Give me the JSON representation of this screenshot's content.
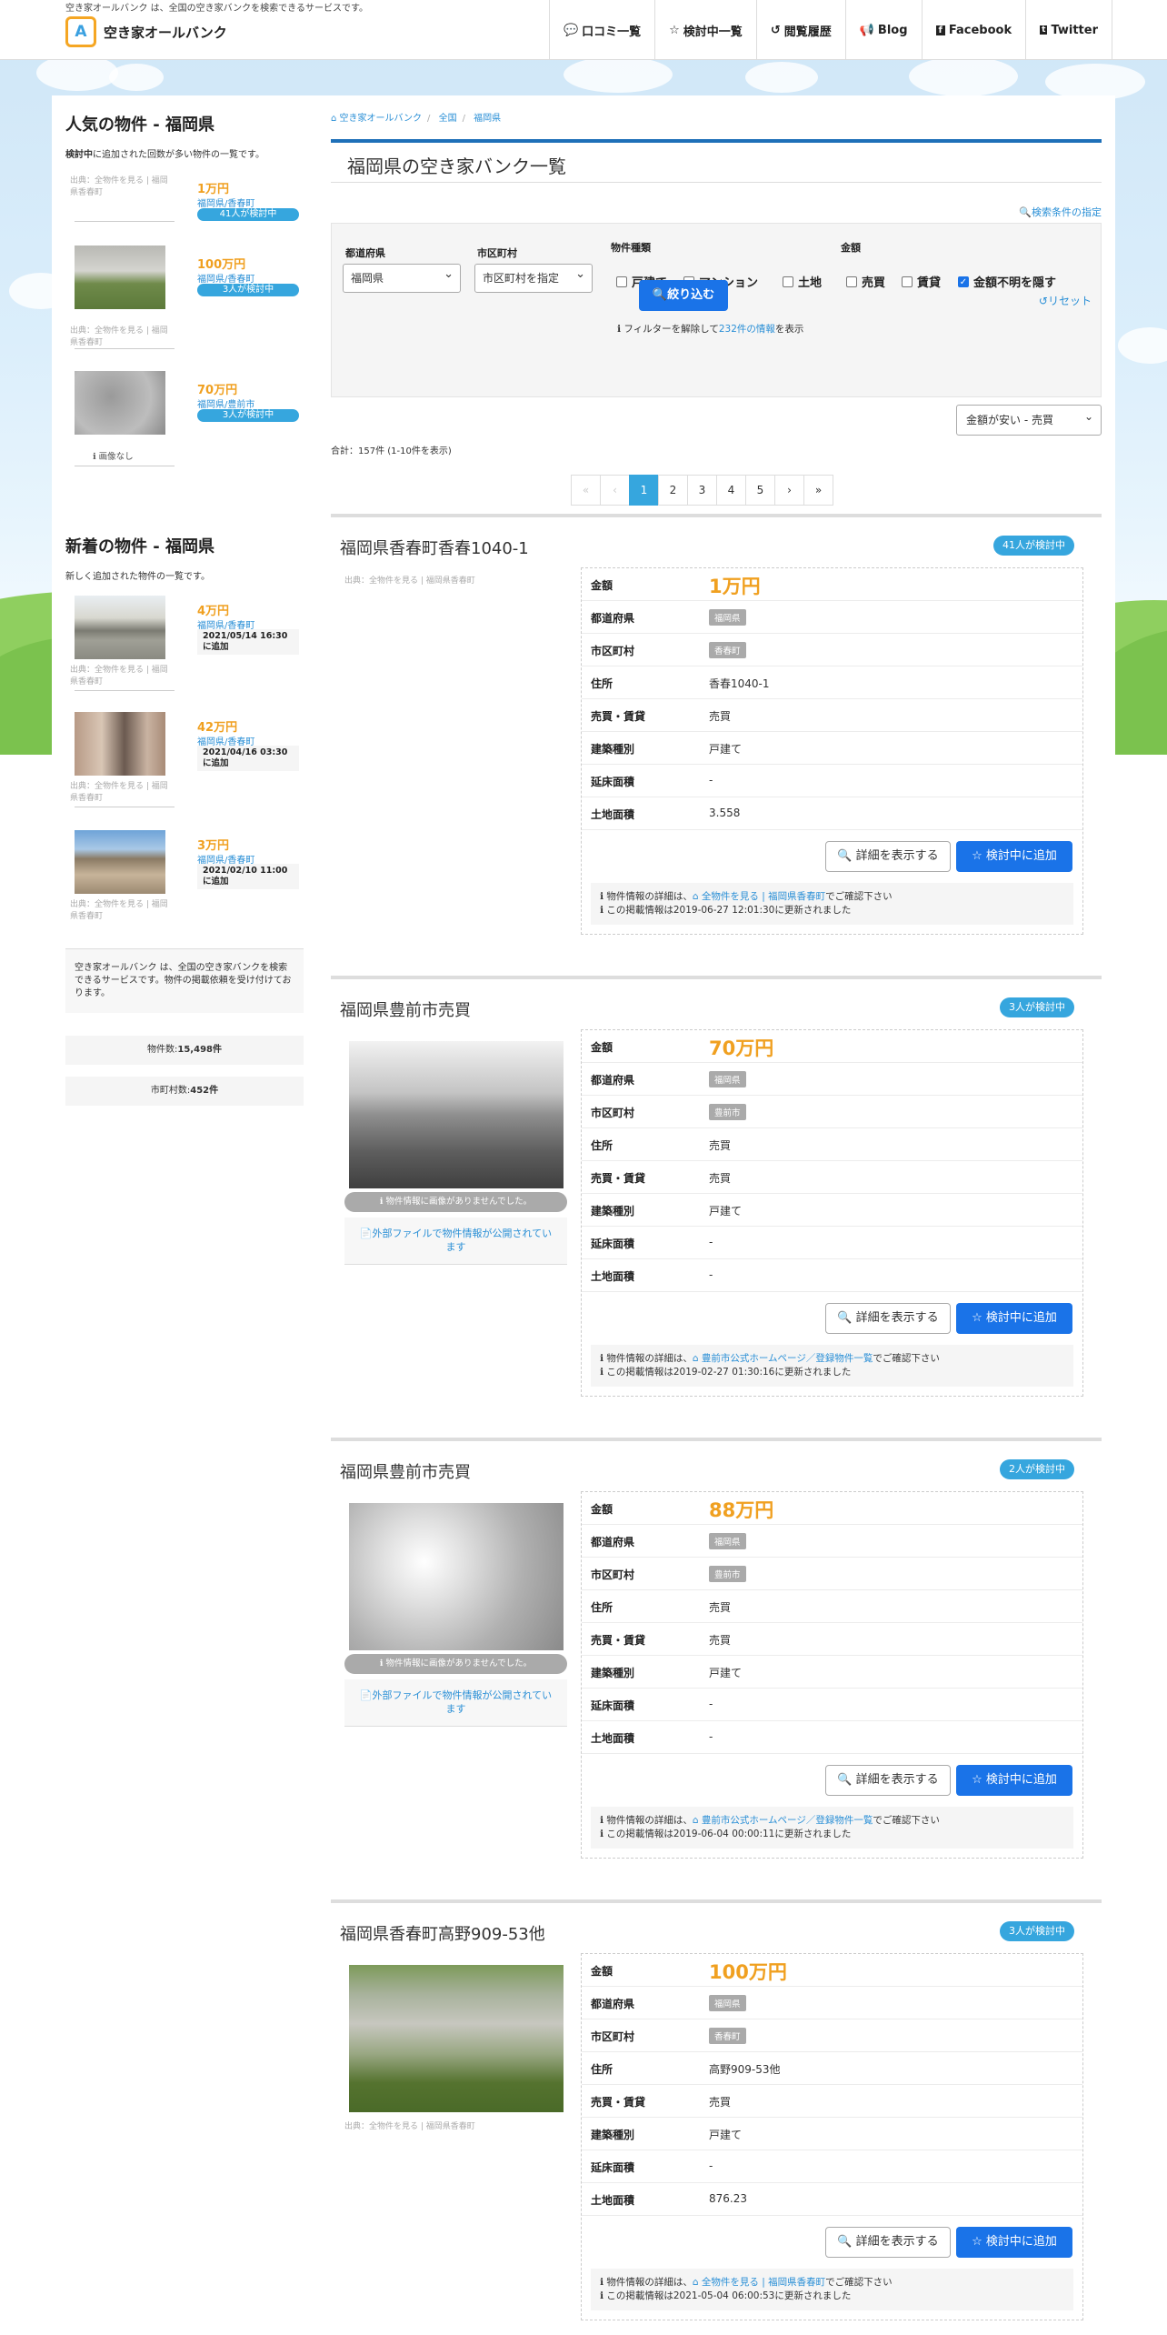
{
  "header": {
    "tagline": "空き家オールバンク は、全国の空き家バンクを検索できるサービスです。",
    "logo_text": "空き家オールバンク",
    "nav": [
      {
        "icon": "comment-icon",
        "label": "口コミ一覧"
      },
      {
        "icon": "star-icon",
        "label": "検討中一覧"
      },
      {
        "icon": "history-icon",
        "label": "閲覧履歴"
      },
      {
        "icon": "bullhorn-icon",
        "label": "Blog"
      },
      {
        "icon": "facebook-icon",
        "label": "Facebook"
      },
      {
        "icon": "twitter-icon",
        "label": "Twitter"
      }
    ]
  },
  "sidebar": {
    "popular": {
      "title": "人気の物件 - 福岡県",
      "subtitle_strong": "検討中",
      "subtitle_rest": "に追加された回数が多い物件の一覧です。",
      "items": [
        {
          "source": "出典：全物件を見る | 福岡県香春町",
          "price": "1万円",
          "location": "福岡県/香春町",
          "badge": "41人が検討中"
        },
        {
          "source": "出典：全物件を見る | 福岡県香春町",
          "price": "100万円",
          "location": "福岡県/香春町",
          "badge": "3人が検討中"
        },
        {
          "no_image": "画像なし",
          "price": "70万円",
          "location": "福岡県/豊前市",
          "badge": "3人が検討中"
        }
      ]
    },
    "new": {
      "title": "新着の物件 - 福岡県",
      "subtitle": "新しく追加された物件の一覧です。",
      "items": [
        {
          "source": "出典：全物件を見る | 福岡県香春町",
          "price": "4万円",
          "location": "福岡県/香春町",
          "date": "2021/05/14 16:30に追加"
        },
        {
          "source": "出典：全物件を見る | 福岡県香春町",
          "price": "42万円",
          "location": "福岡県/香春町",
          "date": "2021/04/16 03:30に追加"
        },
        {
          "source": "出典：全物件を見る | 福岡県香春町",
          "price": "3万円",
          "location": "福岡県/香春町",
          "date": "2021/02/10 11:00に追加"
        }
      ]
    },
    "about": "空き家オールバンク は、全国の空き家バンクを検索できるサービスです。物件の掲載依頼を受け付けております。",
    "stats": [
      {
        "label": "物件数:",
        "value": "15,498件"
      },
      {
        "label": "市町村数:",
        "value": "452件"
      }
    ]
  },
  "breadcrumb": [
    "空き家オールバンク",
    "全国",
    "福岡県"
  ],
  "page_title": "福岡県の空き家バンク一覧",
  "filter": {
    "toggle_label": "検索条件の指定",
    "pref_label": "都道府県",
    "pref_value": "福岡県",
    "city_label": "市区町村",
    "city_value": "市区町村を指定",
    "type_label": "物件種類",
    "types": [
      {
        "label": "戸建て",
        "checked": false
      },
      {
        "label": "マンション",
        "checked": false
      },
      {
        "label": "土地",
        "checked": false
      }
    ],
    "price_label": "金額",
    "prices": [
      {
        "label": "売買",
        "checked": false
      },
      {
        "label": "賃貸",
        "checked": false
      },
      {
        "label": "金額不明を隠す",
        "checked": true
      }
    ],
    "submit": "絞り込む",
    "reset": "リセット",
    "note_pre": "フィルターを解除して",
    "note_link": "232件の情報",
    "note_post": "を表示"
  },
  "sort": "金額が安い - 売買",
  "total": "合計：157件 (1-10件を表示)",
  "pagination": [
    "«",
    "‹",
    "1",
    "2",
    "3",
    "4",
    "5",
    "›",
    "»"
  ],
  "labels": {
    "price": "金額",
    "pref": "都道府県",
    "city": "市区町村",
    "address": "住所",
    "deal": "売買・賃貸",
    "building": "建築種別",
    "floor": "延床面積",
    "land": "土地面積",
    "detail_btn": "詳細を表示する",
    "fav_btn": "検討中に追加",
    "note_pre": "物件情報の詳細は、",
    "note_post": "でご確認下さい",
    "no_image_caption": "物件情報に画像がありませんでした。",
    "external_file": "外部ファイルで物件情報が公開されています"
  },
  "listings": [
    {
      "title": "福岡県香春町香春1040-1",
      "badge": "41人が検討中",
      "source": "出典：全物件を見る | 福岡県香春町",
      "price": "1万円",
      "pref": "福岡県",
      "city": "香春町",
      "address": "香春1040-1",
      "deal": "売買",
      "building": "戸建て",
      "floor": "-",
      "land": "3.558",
      "link": "全物件を見る | 福岡県香春町",
      "updated": "この掲載情報は2019-06-27 12:01:30に更新されました"
    },
    {
      "title": "福岡県豊前市売買",
      "badge": "3人が検討中",
      "price": "70万円",
      "pref": "福岡県",
      "city": "豊前市",
      "address": "売買",
      "deal": "売買",
      "building": "戸建て",
      "floor": "-",
      "land": "-",
      "link": "豊前市公式ホームページ／登録物件一覧",
      "updated": "この掲載情報は2019-02-27 01:30:16に更新されました"
    },
    {
      "title": "福岡県豊前市売買",
      "badge": "2人が検討中",
      "price": "88万円",
      "pref": "福岡県",
      "city": "豊前市",
      "address": "売買",
      "deal": "売買",
      "building": "戸建て",
      "floor": "-",
      "land": "-",
      "link": "豊前市公式ホームページ／登録物件一覧",
      "updated": "この掲載情報は2019-06-04 00:00:11に更新されました"
    },
    {
      "title": "福岡県香春町高野909-53他",
      "badge": "3人が検討中",
      "source": "出典：全物件を見る | 福岡県香春町",
      "price": "100万円",
      "pref": "福岡県",
      "city": "香春町",
      "address": "高野909-53他",
      "deal": "売買",
      "building": "戸建て",
      "floor": "-",
      "land": "876.23",
      "link": "全物件を見る | 福岡県香春町",
      "updated": "この掲載情報は2021-05-04 06:00:53に更新されました"
    }
  ]
}
